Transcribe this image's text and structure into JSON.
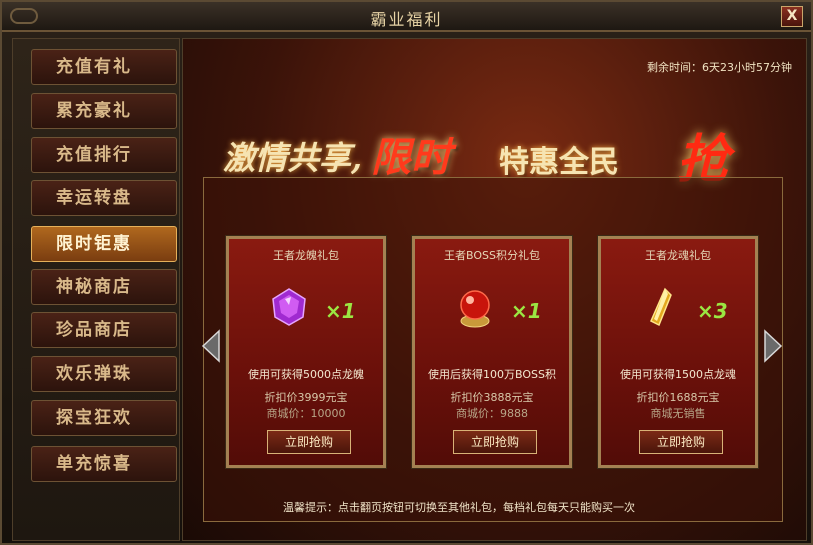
{
  "window": {
    "title": "霸业福利",
    "close_label": "X"
  },
  "sidebar": {
    "items": [
      {
        "label": "充值有礼",
        "active": false
      },
      {
        "label": "累充豪礼",
        "active": false
      },
      {
        "label": "充值排行",
        "active": false
      },
      {
        "label": "幸运转盘",
        "active": false
      },
      {
        "label": "限时钜惠",
        "active": true
      },
      {
        "label": "神秘商店",
        "active": false
      },
      {
        "label": "珍品商店",
        "active": false
      },
      {
        "label": "欢乐弹珠",
        "active": false
      },
      {
        "label": "探宝狂欢",
        "active": false
      },
      {
        "label": "单充惊喜",
        "active": false
      }
    ]
  },
  "main": {
    "timer": "剩余时间：6天23小时57分钟",
    "banner": {
      "part1": "激情共享,",
      "part2": "限时",
      "part3": "特惠全民",
      "part4": "抢"
    },
    "cards": [
      {
        "name": "王者龙魄礼包",
        "item_icon": "purple-gem-icon",
        "qty": "×1",
        "desc": "使用可获得5000点龙魄",
        "price": "折扣价3999元宝",
        "orig": "商城价：10000",
        "buy_label": "立即抢购"
      },
      {
        "name": "王者BOSS积分礼包",
        "item_icon": "red-orb-icon",
        "qty": "×1",
        "desc": "使用后获得100万BOSS积",
        "price": "折扣价3888元宝",
        "orig": "商城价：9888",
        "buy_label": "立即抢购"
      },
      {
        "name": "王者龙魂礼包",
        "item_icon": "gold-crystal-icon",
        "qty": "×3",
        "desc": "使用可获得1500点龙魂",
        "price": "折扣价1688元宝",
        "orig": "商城无销售",
        "buy_label": "立即抢购"
      }
    ],
    "tip": "温馨提示：点击翻页按钮可切换至其他礼包，每档礼包每天只能购买一次"
  },
  "colors": {
    "accent_gold": "#d8b277",
    "active_tab": "#b0681e",
    "qty_green": "#9be642"
  }
}
